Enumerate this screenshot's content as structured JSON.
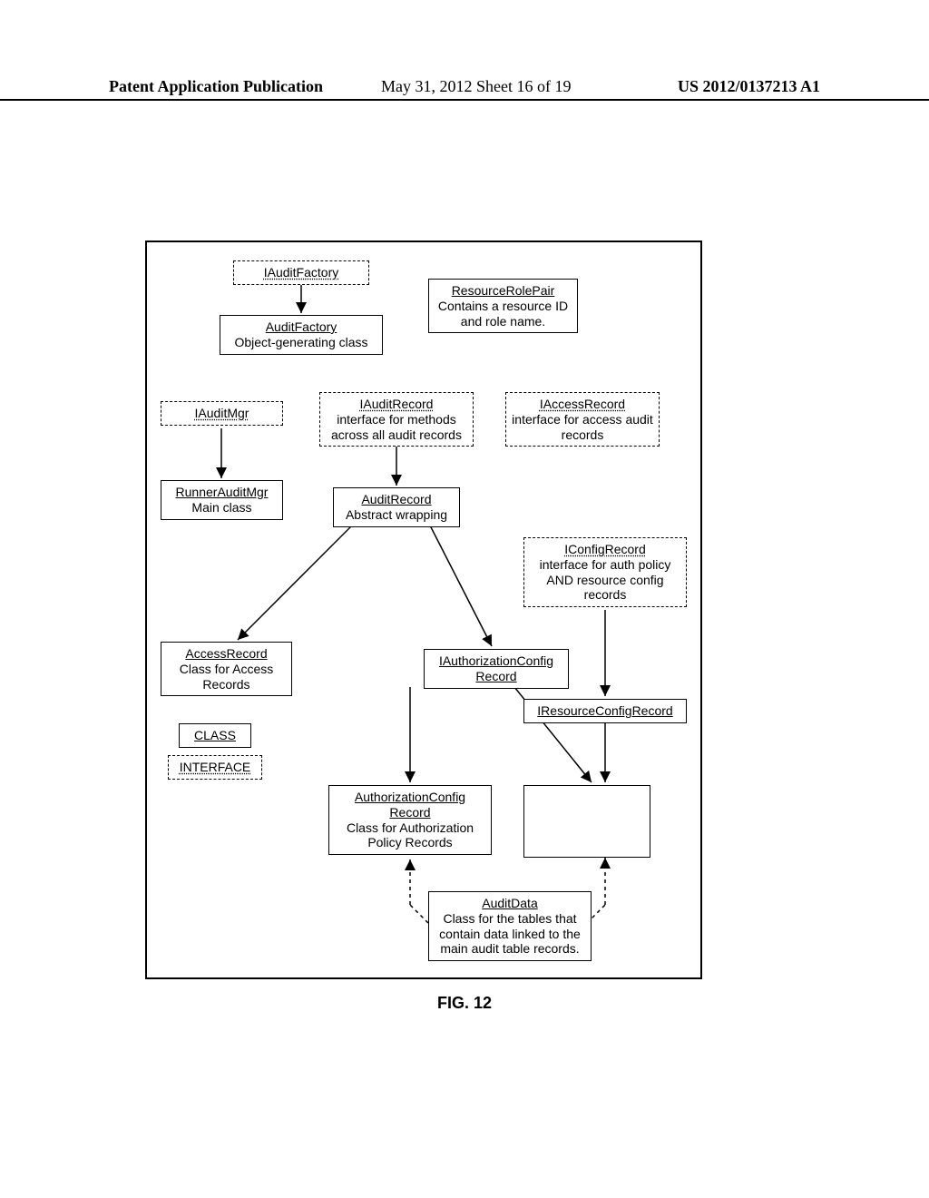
{
  "header": {
    "left": "Patent Application Publication",
    "mid": "May 31, 2012  Sheet 16 of 19",
    "right": "US 2012/0137213 A1"
  },
  "caption": "FIG. 12",
  "legend": {
    "class": "CLASS",
    "interface": "INTERFACE"
  },
  "boxes": {
    "iAuditFactory": "IAuditFactory",
    "auditFactory_title": "AuditFactory",
    "auditFactory_desc": "Object-generating class",
    "resourceRolePair_title": "ResourceRolePair",
    "resourceRolePair_desc": "Contains a resource ID and role name.",
    "iAuditMgr": "IAuditMgr",
    "runnerAuditMgr_title": "RunnerAuditMgr",
    "runnerAuditMgr_desc": "Main class",
    "iAuditRecord_title": "IAuditRecord",
    "iAuditRecord_desc": "interface for methods across all audit records",
    "iAccessRecord_title": "IAccessRecord",
    "iAccessRecord_desc": "interface for access audit records",
    "auditRecord_title": "AuditRecord",
    "auditRecord_desc": "Abstract wrapping",
    "iConfigRecord_title": "IConfigRecord",
    "iConfigRecord_desc": "interface for auth policy AND resource config records",
    "accessRecord_title": "AccessRecord",
    "accessRecord_desc": "Class for Access Records",
    "iAuthorizationConfigRecord": "IAuthorizationConfig Record",
    "iResourceConfigRecord": "IResourceConfigRecord",
    "authorizationConfigRecord_title": "AuthorizationConfig Record",
    "authorizationConfigRecord_desc": "Class for Authorization Policy Records",
    "auditData_title": "AuditData",
    "auditData_desc": "Class for the tables that contain data linked to the main audit table records."
  }
}
